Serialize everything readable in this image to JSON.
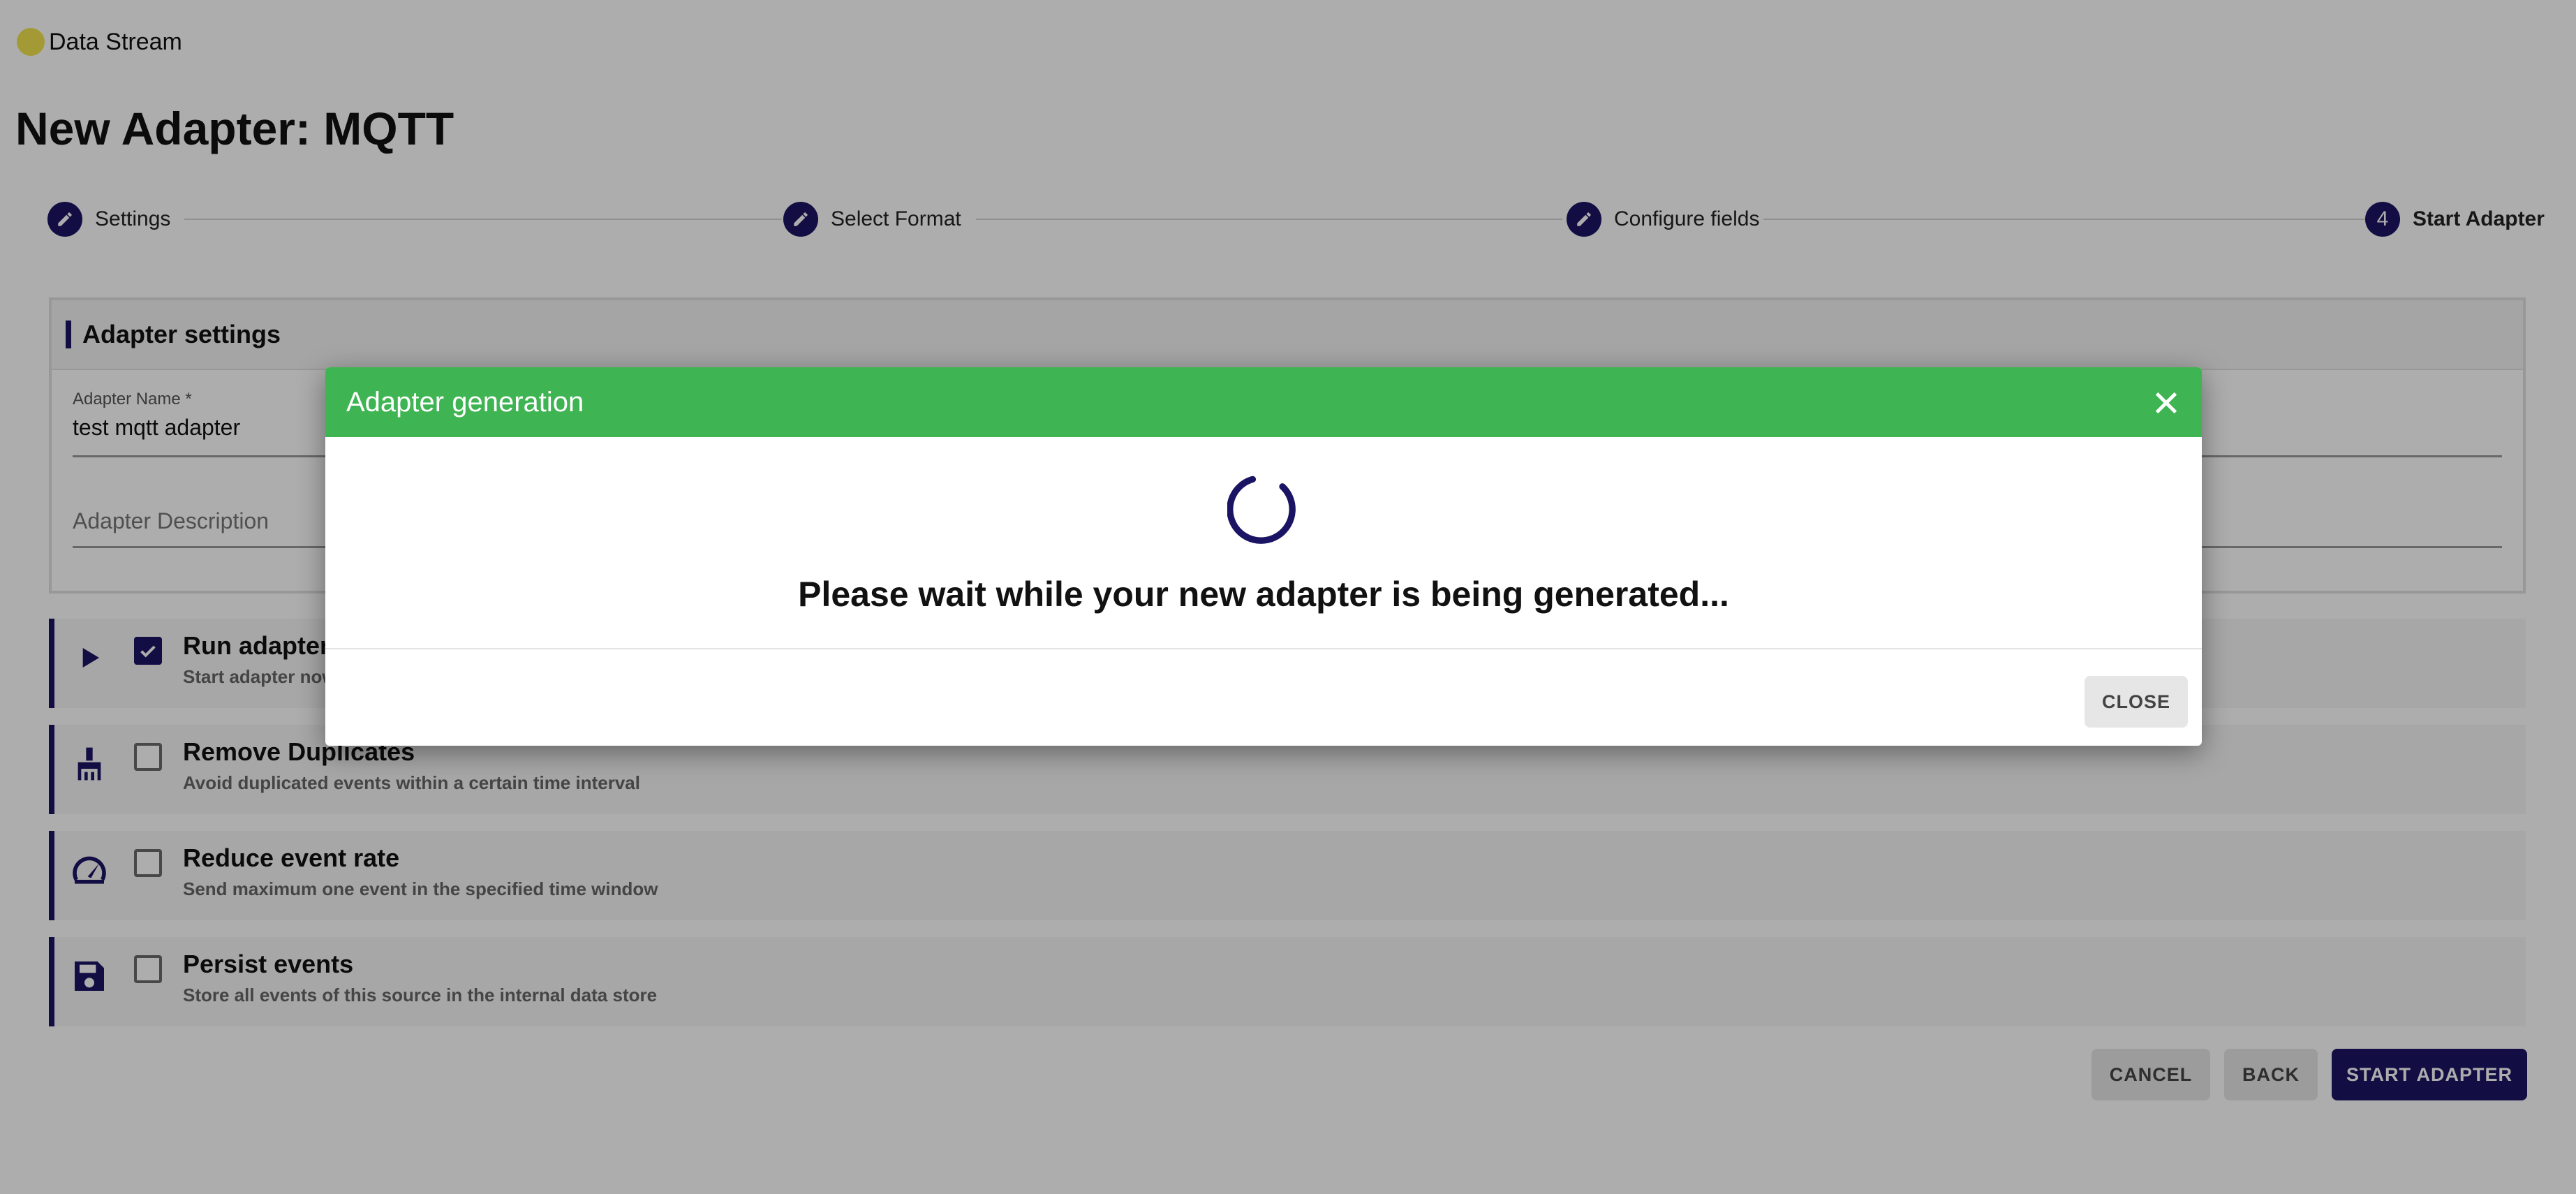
{
  "breadcrumb": {
    "label": "Data Stream"
  },
  "page": {
    "title": "New Adapter: MQTT"
  },
  "stepper": {
    "steps": [
      {
        "label": "Settings",
        "marker": "edit-icon"
      },
      {
        "label": "Select Format",
        "marker": "edit-icon"
      },
      {
        "label": "Configure fields",
        "marker": "edit-icon"
      },
      {
        "label": "Start Adapter",
        "number": "4"
      }
    ]
  },
  "settings_card": {
    "title": "Adapter settings",
    "name_label": "Adapter Name *",
    "name_value": "test mqtt adapter",
    "description_placeholder": "Adapter Description"
  },
  "options": [
    {
      "icon": "play-icon",
      "title": "Run adapter",
      "desc": "Start adapter now",
      "checked": true
    },
    {
      "icon": "broom-icon",
      "title": "Remove Duplicates",
      "desc": "Avoid duplicated events within a certain time interval",
      "checked": false
    },
    {
      "icon": "speedometer-icon",
      "title": "Reduce event rate",
      "desc": "Send maximum one event in the specified time window",
      "checked": false
    },
    {
      "icon": "floppy-disk-icon",
      "title": "Persist events",
      "desc": "Store all events of this source in the internal data store",
      "checked": false
    }
  ],
  "actions": {
    "cancel": "CANCEL",
    "back": "BACK",
    "start": "START ADAPTER"
  },
  "dialog": {
    "title": "Adapter generation",
    "message": "Please wait while your new adapter is being generated...",
    "close_label": "CLOSE"
  },
  "colors": {
    "primary": "#1b1464",
    "success": "#3fb452",
    "accent_dot": "#f0e24e"
  }
}
